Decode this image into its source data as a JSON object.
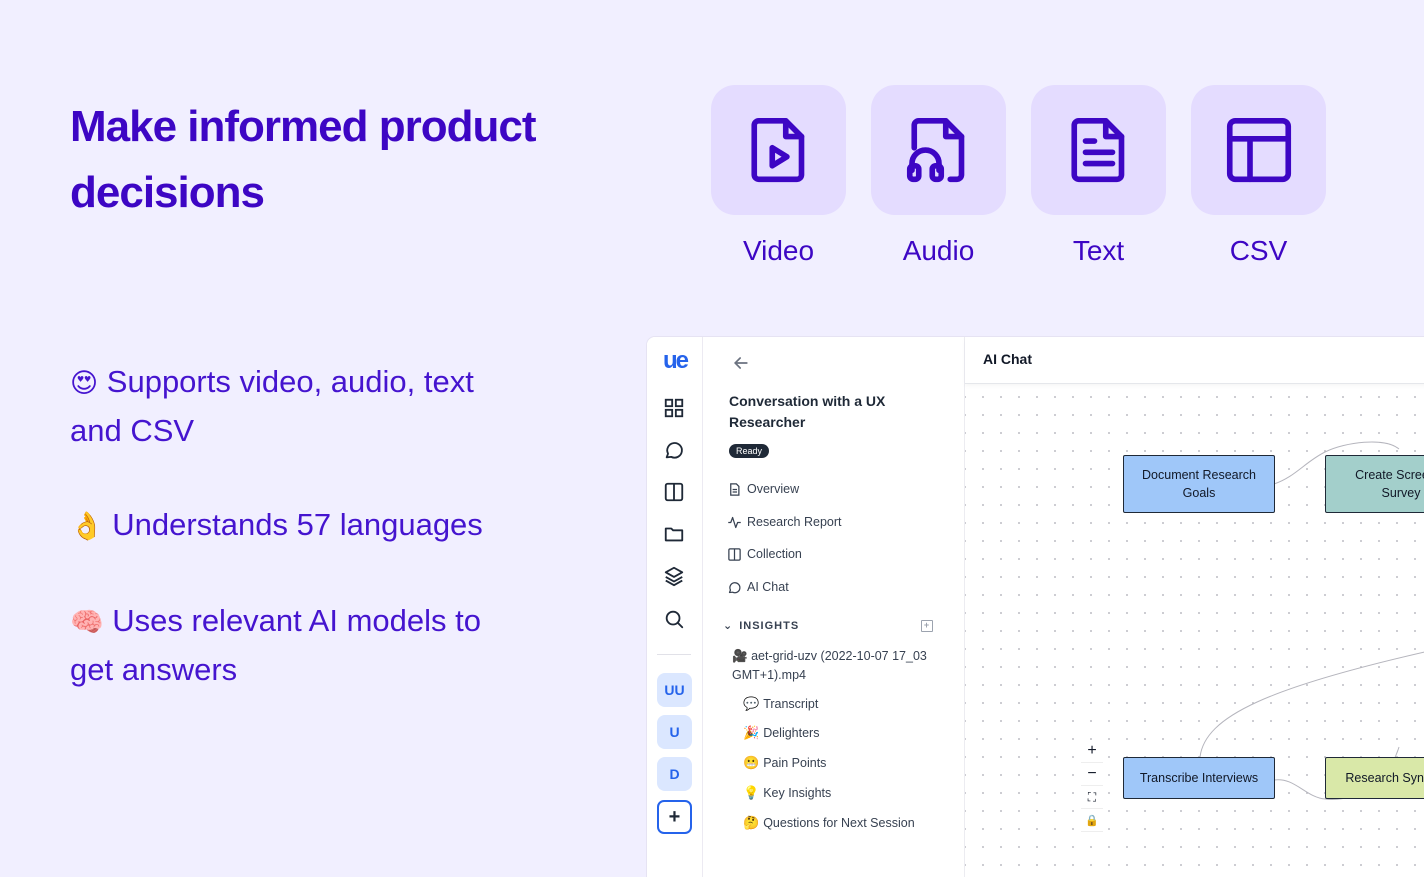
{
  "headline": "Make informed product decisions",
  "formats": [
    {
      "label": "Video",
      "icon": "video-file-icon"
    },
    {
      "label": "Audio",
      "icon": "audio-file-icon"
    },
    {
      "label": "Text",
      "icon": "text-file-icon"
    },
    {
      "label": "CSV",
      "icon": "table-icon"
    }
  ],
  "features": [
    {
      "emoji": "😍",
      "text": "Supports video, audio, text and CSV"
    },
    {
      "emoji": "👌",
      "text": "Understands 57 languages"
    },
    {
      "emoji": "🧠",
      "text": "Uses relevant AI models to get answers"
    }
  ],
  "app": {
    "logo": "ue",
    "avatars": [
      "UU",
      "U",
      "D"
    ],
    "add_label": "+",
    "conversation_title": "Conversation with a UX Researcher",
    "status": "Ready",
    "nav": [
      "Overview",
      "Research Report",
      "Collection",
      "AI Chat"
    ],
    "insights": {
      "heading": "INSIGHTS",
      "file": {
        "emoji": "🎥",
        "name": "aet-grid-uzv (2022-10-07 17_03 GMT+1).mp4"
      },
      "items": [
        {
          "emoji": "💬",
          "label": "Transcript"
        },
        {
          "emoji": "🎉",
          "label": "Delighters"
        },
        {
          "emoji": "😬",
          "label": "Pain Points"
        },
        {
          "emoji": "💡",
          "label": "Key Insights"
        },
        {
          "emoji": "🤔",
          "label": "Questions for Next Session"
        }
      ]
    },
    "canvas": {
      "title": "AI Chat",
      "nodes": [
        {
          "label": "Document Research Goals",
          "color": "#9fc7f9"
        },
        {
          "label": "Create Screener Survey",
          "color": "#a3cfcb"
        },
        {
          "label": "Transcribe Interviews",
          "color": "#9fc7f9"
        },
        {
          "label": "Research Synthesis",
          "color": "#d9e8a8"
        }
      ],
      "zoom": [
        "+",
        "−",
        "⛶",
        "🔒"
      ]
    }
  }
}
